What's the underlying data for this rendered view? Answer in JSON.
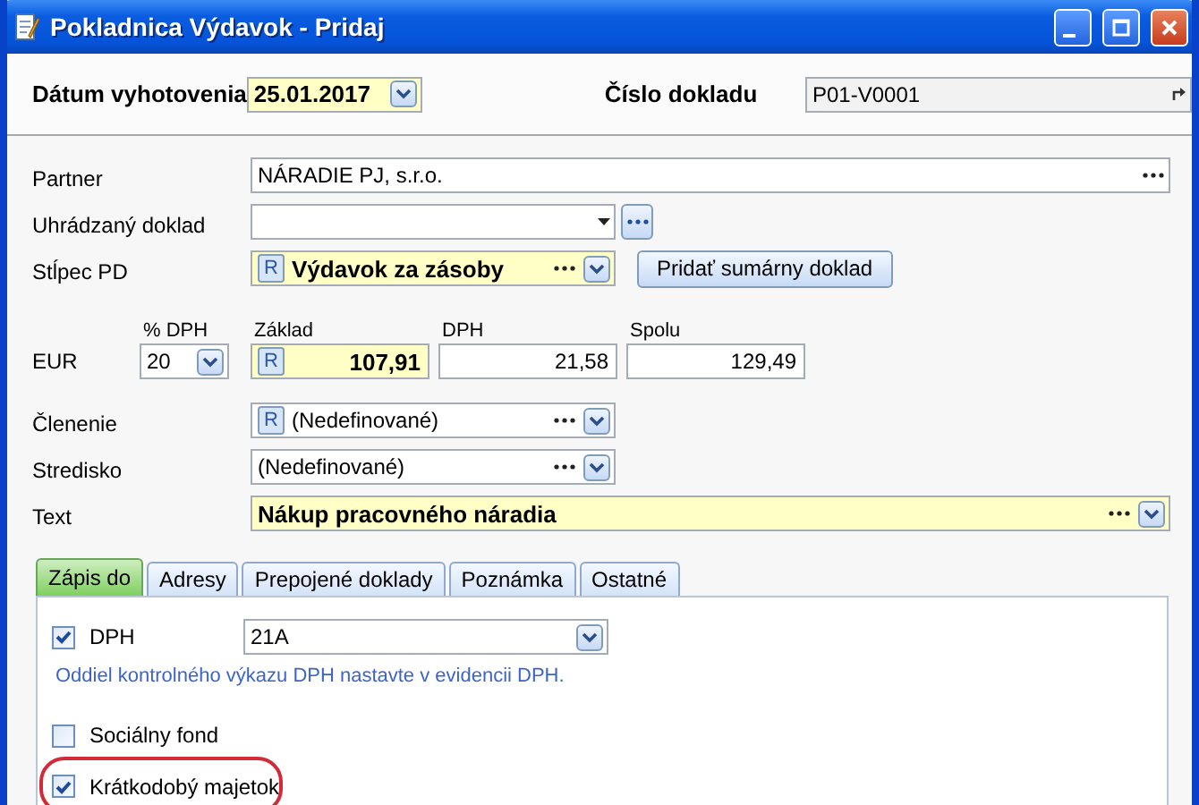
{
  "window": {
    "title": "Pokladnica Výdavok - Pridaj"
  },
  "header": {
    "date_label": "Dátum vyhotovenia",
    "date": {
      "value": "25.01.2017",
      "highlighted": true,
      "dropdown_button": true
    },
    "number_label": "Číslo dokladu",
    "number": {
      "value": "P01-V0001",
      "readonly": true
    }
  },
  "rows": [
    {
      "label": "Partner",
      "field": {
        "kind": "line",
        "value": "NÁRADIE PJ, s.r.o.",
        "dots": true
      }
    },
    {
      "label": "Uhrádzaný doklad",
      "field": {
        "kind": "combo",
        "caret": true,
        "lookup": true
      }
    },
    {
      "label": "Stĺpec PD",
      "field": {
        "kind": "combo",
        "badge": "R",
        "value": "Výdavok za zásoby",
        "highlighted": true,
        "dots": true,
        "dropdown_button": true
      },
      "button": "Pridať sumárny doklad"
    },
    {
      "kind": "amounts",
      "label": "EUR",
      "columns": [
        {
          "header": "% DPH",
          "kind": "percent",
          "value": "20",
          "dropdown_button": true
        },
        {
          "header": "Základ",
          "kind": "amount",
          "badge": "R",
          "value": "107,91",
          "highlighted": true
        },
        {
          "header": "DPH",
          "kind": "amount",
          "value": "21,58"
        },
        {
          "header": "Spolu",
          "kind": "amount",
          "value": "129,49"
        }
      ]
    },
    {
      "label": "Členenie",
      "field": {
        "kind": "combo",
        "badge": "R",
        "value": "(Nedefinované)",
        "dots": true,
        "dropdown_button": true
      }
    },
    {
      "label": "Stredisko",
      "field": {
        "kind": "combo",
        "value": "(Nedefinované)",
        "dots": true,
        "dropdown_button": true
      }
    },
    {
      "label": "Text",
      "field": {
        "kind": "line",
        "value": "Nákup pracovného náradia",
        "highlighted": true,
        "dots": true,
        "dropdown_button": true
      }
    }
  ],
  "tabs": [
    {
      "label": "Zápis do",
      "selected": true
    },
    {
      "label": "Adresy",
      "selected": false
    },
    {
      "label": "Prepojené doklady",
      "selected": false
    },
    {
      "label": "Poznámka",
      "selected": false
    },
    {
      "label": "Ostatné",
      "selected": false
    }
  ],
  "panel": {
    "dph": {
      "label": "DPH",
      "checked": true,
      "field": {
        "kind": "combo",
        "value": "21A",
        "dropdown_button": true
      }
    },
    "note": "Oddiel kontrolného výkazu DPH nastavte v evidencii DPH.",
    "checkboxes": [
      {
        "label": "Sociálny fond",
        "checked": false,
        "highlighted": false
      },
      {
        "label": "Krátkodobý majetok",
        "checked": true,
        "highlighted": true
      }
    ]
  }
}
